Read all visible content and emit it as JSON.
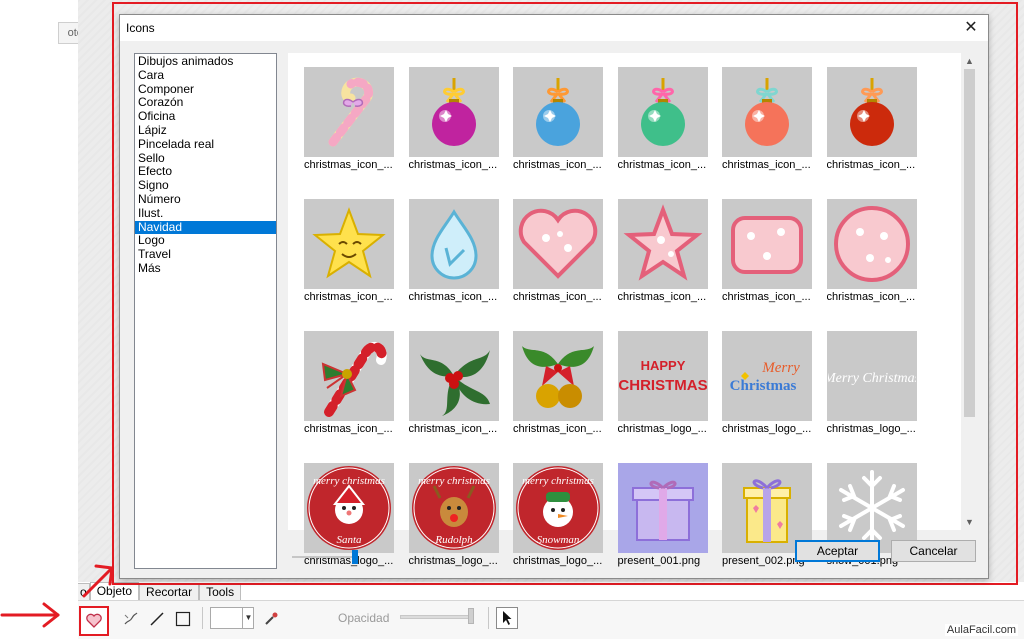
{
  "background_app": {
    "tab_stub_label": "otes",
    "bottom_tabs": [
      "o",
      "Objeto",
      "Recortar",
      "Tools"
    ],
    "opacity_label": "Opacidad",
    "watermark": "AulaFacil.com"
  },
  "dialog": {
    "title": "Icons",
    "close_glyph": "✕",
    "categories": [
      "Dibujos animados",
      "Cara",
      "Componer",
      "Corazón",
      "Oficina",
      "Lápiz",
      "Pincelada real",
      "Sello",
      "Efecto",
      "Signo",
      "Número",
      "Ilust.",
      "Navidad",
      "Logo",
      "Travel",
      "Más"
    ],
    "selected_category": "Navidad",
    "icons": [
      {
        "caption": "christmas_icon_...",
        "art": "candy-cane-bow"
      },
      {
        "caption": "christmas_icon_...",
        "art": "ornament-magenta"
      },
      {
        "caption": "christmas_icon_...",
        "art": "ornament-blue"
      },
      {
        "caption": "christmas_icon_...",
        "art": "ornament-green"
      },
      {
        "caption": "christmas_icon_...",
        "art": "ornament-coral"
      },
      {
        "caption": "christmas_icon_...",
        "art": "ornament-red"
      },
      {
        "caption": "christmas_icon_...",
        "art": "smiling-star"
      },
      {
        "caption": "christmas_icon_...",
        "art": "water-drop"
      },
      {
        "caption": "christmas_icon_...",
        "art": "pink-heart"
      },
      {
        "caption": "christmas_icon_...",
        "art": "pink-star"
      },
      {
        "caption": "christmas_icon_...",
        "art": "pink-square"
      },
      {
        "caption": "christmas_icon_...",
        "art": "pink-circle"
      },
      {
        "caption": "christmas_icon_...",
        "art": "candy-cane-ribbon"
      },
      {
        "caption": "christmas_icon_...",
        "art": "holly"
      },
      {
        "caption": "christmas_icon_...",
        "art": "holly-bells"
      },
      {
        "caption": "christmas_logo_...",
        "art": "logo-text",
        "text": "HAPPY CHRISTMAS"
      },
      {
        "caption": "christmas_logo_...",
        "art": "logo-text-color",
        "text": "Merry Christmas"
      },
      {
        "caption": "christmas_logo_...",
        "art": "logo-script",
        "text": "Merry Christmas"
      },
      {
        "caption": "christmas_logo_...",
        "art": "badge-santa",
        "text": "Santa",
        "arc": "merry christmas"
      },
      {
        "caption": "christmas_logo_...",
        "art": "badge-rudolph",
        "text": "Rudolph",
        "arc": "merry christmas"
      },
      {
        "caption": "christmas_logo_...",
        "art": "badge-snowman",
        "text": "Snowman",
        "arc": "merry christmas"
      },
      {
        "caption": "present_001.png",
        "art": "present-purple"
      },
      {
        "caption": "present_002.png",
        "art": "present-yellow"
      },
      {
        "caption": "snow_001.png",
        "art": "snowflake"
      }
    ],
    "accept_label": "Aceptar",
    "cancel_label": "Cancelar",
    "scroll_up_glyph": "▲",
    "scroll_down_glyph": "▼"
  },
  "colors": {
    "highlight_red": "#e31b23",
    "selection_blue": "#0078d7",
    "thumb_bg": "#c9c9c9"
  }
}
